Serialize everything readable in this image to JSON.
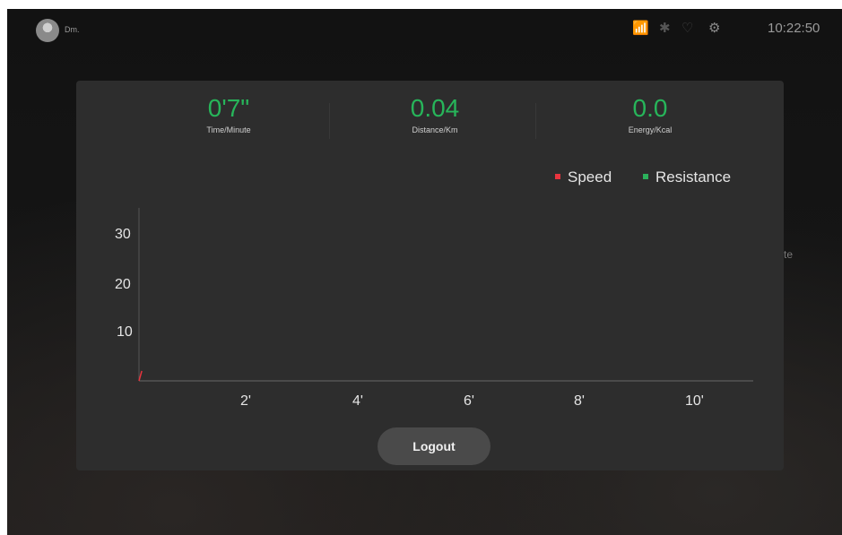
{
  "status_bar": {
    "username": "Dm.",
    "time": "10:22:50",
    "icons": [
      "wifi-icon",
      "bluetooth-icon",
      "heart-shield-icon",
      "settings-gear-icon"
    ]
  },
  "background": {
    "partial_text": "te"
  },
  "modal": {
    "stats": [
      {
        "value": "0'7\"",
        "label": "Time/Minute"
      },
      {
        "value": "0.04",
        "label": "Distance/Km"
      },
      {
        "value": "0.0",
        "label": "Energy/Kcal"
      }
    ],
    "legend": [
      {
        "label": "Speed",
        "color": "#e8343e"
      },
      {
        "label": "Resistance",
        "color": "#2bb15b"
      }
    ],
    "logout_label": "Logout"
  },
  "colors": {
    "stat_value": "#27b55a",
    "panel": "#2d2d2d",
    "button": "#4a4a4a"
  },
  "chart_data": {
    "type": "line",
    "y_ticks": [
      "10",
      "20",
      "30"
    ],
    "x_ticks": [
      "2'",
      "4'",
      "6'",
      "8'",
      "10'"
    ],
    "ylim": [
      0,
      35
    ],
    "xlim": [
      0,
      11
    ],
    "series": [
      {
        "name": "Speed",
        "color": "#e8343e",
        "x": [
          0,
          0.05
        ],
        "y": [
          0,
          2
        ]
      },
      {
        "name": "Resistance",
        "color": "#2bb15b",
        "x": [],
        "y": []
      }
    ]
  }
}
